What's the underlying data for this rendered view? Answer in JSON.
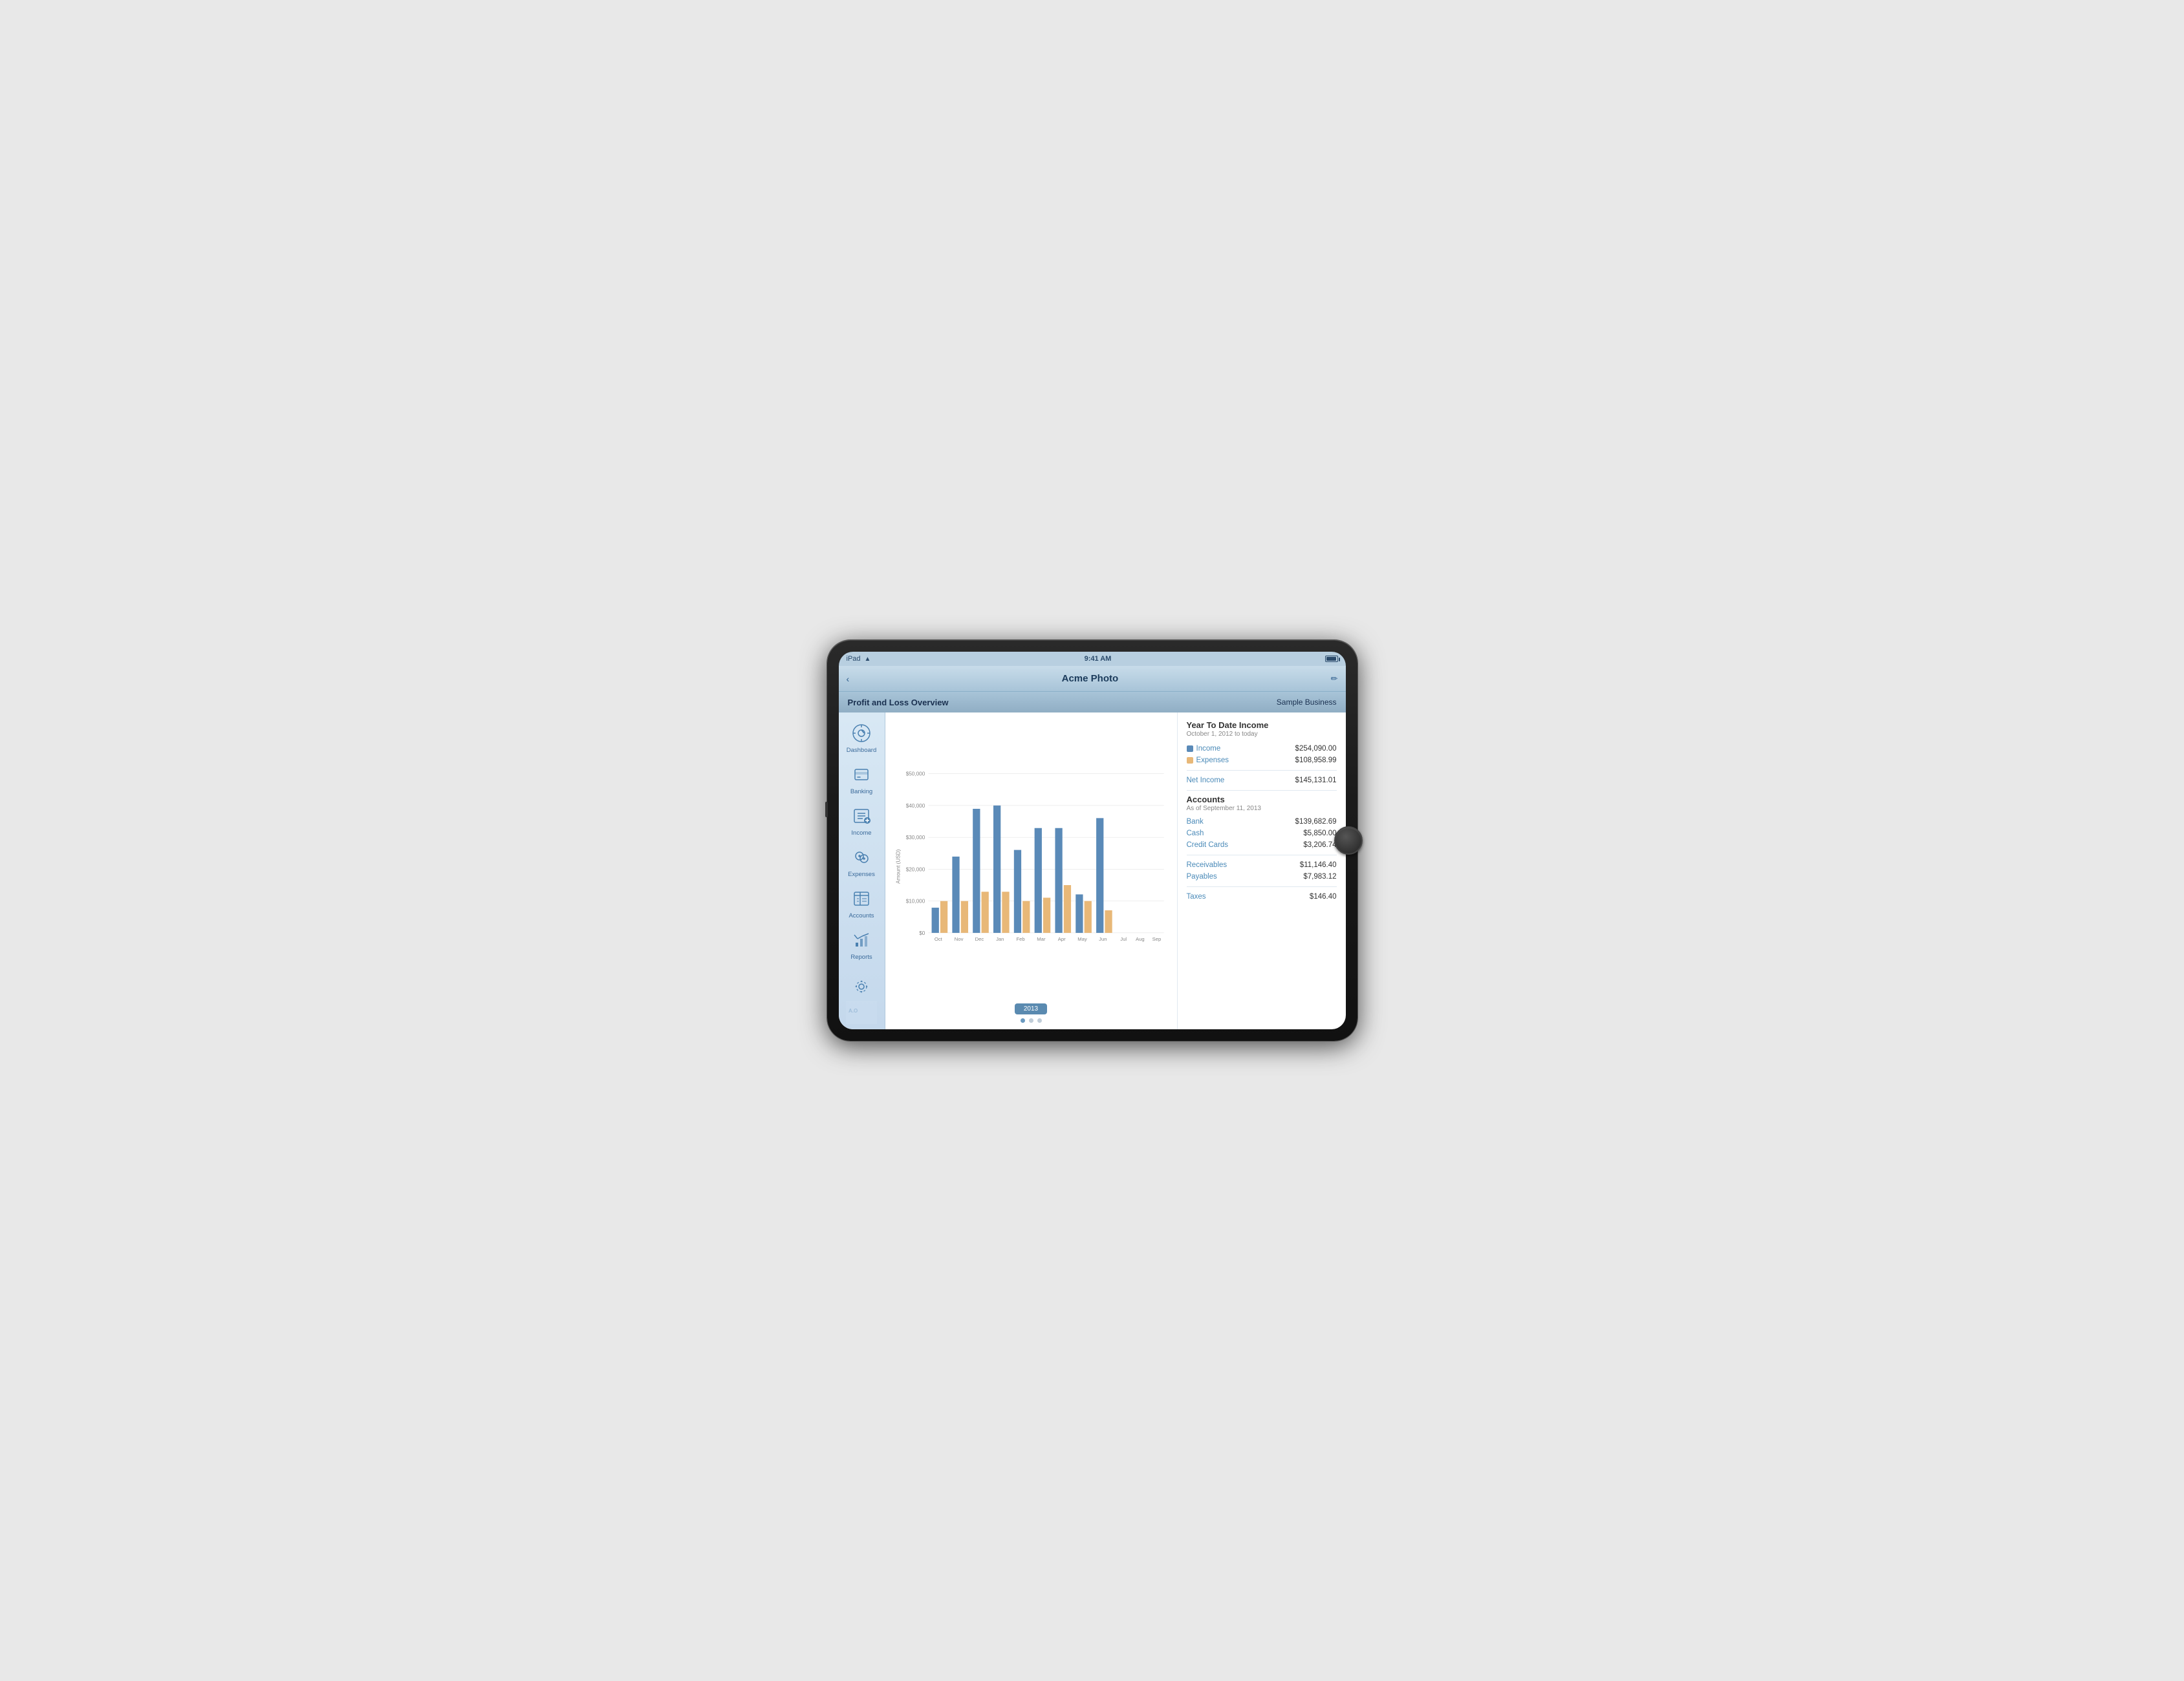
{
  "device": {
    "status_bar": {
      "device": "iPad",
      "time": "9:41 AM",
      "battery_level": 85
    }
  },
  "nav": {
    "back_label": "‹",
    "title": "Acme Photo",
    "edit_icon": "✏"
  },
  "header": {
    "title": "Profit and Loss Overview",
    "subtitle": "Sample Business"
  },
  "sidebar": {
    "items": [
      {
        "id": "dashboard",
        "label": "Dashboard",
        "icon": "dashboard"
      },
      {
        "id": "banking",
        "label": "Banking",
        "icon": "banking"
      },
      {
        "id": "income",
        "label": "Income",
        "icon": "income"
      },
      {
        "id": "expenses",
        "label": "Expenses",
        "icon": "expenses"
      },
      {
        "id": "accounts",
        "label": "Accounts",
        "icon": "accounts"
      },
      {
        "id": "reports",
        "label": "Reports",
        "icon": "reports"
      }
    ],
    "settings_icon": "⚙"
  },
  "chart": {
    "y_axis_label": "Amount (USD)",
    "y_labels": [
      "$50,000",
      "$40,000",
      "$30,000",
      "$20,000",
      "$10,000",
      "$0"
    ],
    "x_labels": [
      "Oct",
      "Nov",
      "Dec",
      "Jan",
      "Feb",
      "Mar",
      "Apr",
      "May",
      "Jun",
      "Jul",
      "Aug",
      "Sep"
    ],
    "year_button": "2013",
    "bars": [
      {
        "month": "Oct",
        "income": 8,
        "expense": 10
      },
      {
        "month": "Nov",
        "income": 24,
        "expense": 10
      },
      {
        "month": "Dec",
        "income": 39,
        "expense": 13
      },
      {
        "month": "Jan",
        "income": 40,
        "expense": 13
      },
      {
        "month": "Feb",
        "income": 26,
        "expense": 10
      },
      {
        "month": "Mar",
        "income": 33,
        "expense": 11
      },
      {
        "month": "Apr",
        "income": 33,
        "expense": 15
      },
      {
        "month": "May",
        "income": 12,
        "expense": 10
      },
      {
        "month": "Jun",
        "income": 36,
        "expense": 7
      },
      {
        "month": "Jul",
        "income": 0,
        "expense": 0
      },
      {
        "month": "Aug",
        "income": 0,
        "expense": 0
      },
      {
        "month": "Sep",
        "income": 0,
        "expense": 0
      }
    ]
  },
  "stats": {
    "ytd_title": "Year To Date Income",
    "ytd_subtitle": "October 1, 2012 to today",
    "income_label": "Income",
    "income_value": "$254,090.00",
    "income_color": "#5a8ab8",
    "expenses_label": "Expenses",
    "expenses_value": "$108,958.99",
    "expenses_color": "#e8b878",
    "net_income_label": "Net Income",
    "net_income_value": "$145,131.01",
    "accounts_title": "Accounts",
    "accounts_subtitle": "As of September 11, 2013",
    "bank_label": "Bank",
    "bank_value": "$139,682.69",
    "cash_label": "Cash",
    "cash_value": "$5,850.00",
    "credit_label": "Credit Cards",
    "credit_value": "$3,206.74",
    "receivables_label": "Receivables",
    "receivables_value": "$11,146.40",
    "payables_label": "Payables",
    "payables_value": "$7,983.12",
    "taxes_label": "Taxes",
    "taxes_value": "$146.40"
  },
  "pagination": {
    "dots": [
      {
        "active": true
      },
      {
        "active": false
      },
      {
        "active": false
      }
    ]
  }
}
